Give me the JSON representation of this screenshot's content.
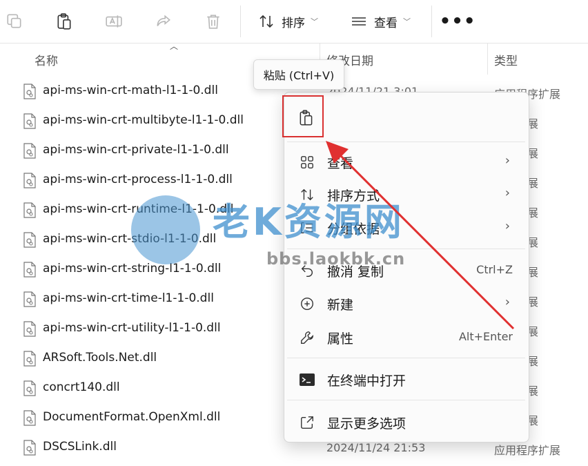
{
  "toolbar": {
    "sort_label": "排序",
    "view_label": "查看",
    "more_label": "•••"
  },
  "columns": {
    "name": "名称",
    "date": "修改日期",
    "type": "类型"
  },
  "files": [
    {
      "name": "api-ms-win-crt-math-l1-1-0.dll",
      "date": "2024/11/21 3:01",
      "type": "应用程序扩展"
    },
    {
      "name": "api-ms-win-crt-multibyte-l1-1-0.dll",
      "date": "",
      "type": "程序扩展"
    },
    {
      "name": "api-ms-win-crt-private-l1-1-0.dll",
      "date": "",
      "type": "程序扩展"
    },
    {
      "name": "api-ms-win-crt-process-l1-1-0.dll",
      "date": "",
      "type": "程序扩展"
    },
    {
      "name": "api-ms-win-crt-runtime-l1-1-0.dll",
      "date": "",
      "type": "程序扩展"
    },
    {
      "name": "api-ms-win-crt-stdio-l1-1-0.dll",
      "date": "",
      "type": "程序扩展"
    },
    {
      "name": "api-ms-win-crt-string-l1-1-0.dll",
      "date": "",
      "type": "程序扩展"
    },
    {
      "name": "api-ms-win-crt-time-l1-1-0.dll",
      "date": "",
      "type": "程序扩展"
    },
    {
      "name": "api-ms-win-crt-utility-l1-1-0.dll",
      "date": "",
      "type": "程序扩展"
    },
    {
      "name": "ARSoft.Tools.Net.dll",
      "date": "",
      "type": "程序扩展"
    },
    {
      "name": "concrt140.dll",
      "date": "",
      "type": "程序扩展"
    },
    {
      "name": "DocumentFormat.OpenXml.dll",
      "date": "",
      "type": "程序扩展"
    },
    {
      "name": "DSCSLink.dll",
      "date": "2024/11/24 21:53",
      "type": "应用程序扩展"
    }
  ],
  "tooltip": {
    "text": "粘贴 (Ctrl+V)"
  },
  "context_menu": {
    "view": "查看",
    "sort_by": "排序方式",
    "group_by": "分组依据",
    "undo_copy": "撤消 复制",
    "undo_shortcut": "Ctrl+Z",
    "new": "新建",
    "properties": "属性",
    "properties_shortcut": "Alt+Enter",
    "open_in_terminal": "在终端中打开",
    "show_more_options": "显示更多选项"
  },
  "watermark": {
    "title": "老K资源网",
    "subtitle": "bbs.laokbk.cn"
  },
  "colors": {
    "highlight_border": "#d93030",
    "arrow": "#e03030",
    "watermark_blue": "#3f8fcd"
  }
}
